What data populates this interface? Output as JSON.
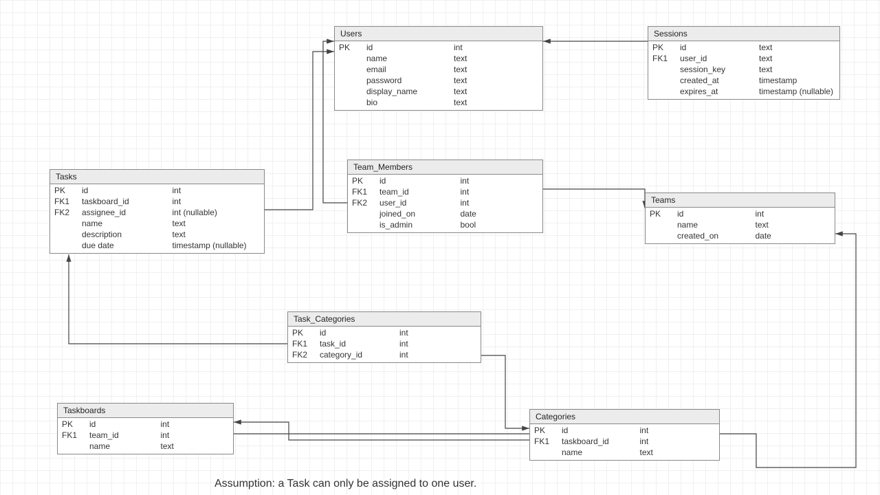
{
  "entities": {
    "users": {
      "title": "Users",
      "cols": [
        {
          "key": "PK",
          "name": "id",
          "type": "int"
        },
        {
          "key": "",
          "name": "name",
          "type": "text"
        },
        {
          "key": "",
          "name": "email",
          "type": "text"
        },
        {
          "key": "",
          "name": "password",
          "type": "text"
        },
        {
          "key": "",
          "name": "display_name",
          "type": "text"
        },
        {
          "key": "",
          "name": "bio",
          "type": "text"
        }
      ]
    },
    "sessions": {
      "title": "Sessions",
      "cols": [
        {
          "key": "PK",
          "name": "id",
          "type": "text"
        },
        {
          "key": "FK1",
          "name": "user_id",
          "type": "text"
        },
        {
          "key": "",
          "name": "session_key",
          "type": "text"
        },
        {
          "key": "",
          "name": "created_at",
          "type": "timestamp"
        },
        {
          "key": "",
          "name": "expires_at",
          "type": "timestamp (nullable)"
        }
      ]
    },
    "tasks": {
      "title": "Tasks",
      "cols": [
        {
          "key": "PK",
          "name": "id",
          "type": "int"
        },
        {
          "key": "FK1",
          "name": "taskboard_id",
          "type": "int"
        },
        {
          "key": "FK2",
          "name": "assignee_id",
          "type": "int (nullable)"
        },
        {
          "key": "",
          "name": "name",
          "type": "text"
        },
        {
          "key": "",
          "name": "description",
          "type": "text"
        },
        {
          "key": "",
          "name": "due date",
          "type": "timestamp (nullable)"
        }
      ]
    },
    "team_members": {
      "title": "Team_Members",
      "cols": [
        {
          "key": "PK",
          "name": "id",
          "type": "int"
        },
        {
          "key": "FK1",
          "name": "team_id",
          "type": "int"
        },
        {
          "key": "FK2",
          "name": "user_id",
          "type": "int"
        },
        {
          "key": "",
          "name": "joined_on",
          "type": "date"
        },
        {
          "key": "",
          "name": "is_admin",
          "type": "bool"
        }
      ]
    },
    "teams": {
      "title": "Teams",
      "cols": [
        {
          "key": "PK",
          "name": "id",
          "type": "int"
        },
        {
          "key": "",
          "name": "name",
          "type": "text"
        },
        {
          "key": "",
          "name": "created_on",
          "type": "date"
        }
      ]
    },
    "task_categories": {
      "title": "Task_Categories",
      "cols": [
        {
          "key": "PK",
          "name": "id",
          "type": "int"
        },
        {
          "key": "FK1",
          "name": "task_id",
          "type": "int"
        },
        {
          "key": "FK2",
          "name": "category_id",
          "type": "int"
        }
      ]
    },
    "taskboards": {
      "title": "Taskboards",
      "cols": [
        {
          "key": "PK",
          "name": "id",
          "type": "int"
        },
        {
          "key": "FK1",
          "name": "team_id",
          "type": "int"
        },
        {
          "key": "",
          "name": "name",
          "type": "text"
        }
      ]
    },
    "categories": {
      "title": "Categories",
      "cols": [
        {
          "key": "PK",
          "name": "id",
          "type": "int"
        },
        {
          "key": "FK1",
          "name": "taskboard_id",
          "type": "int"
        },
        {
          "key": "",
          "name": "name",
          "type": "text"
        }
      ]
    }
  },
  "note": "Assumption: a Task can only be assigned to one user."
}
